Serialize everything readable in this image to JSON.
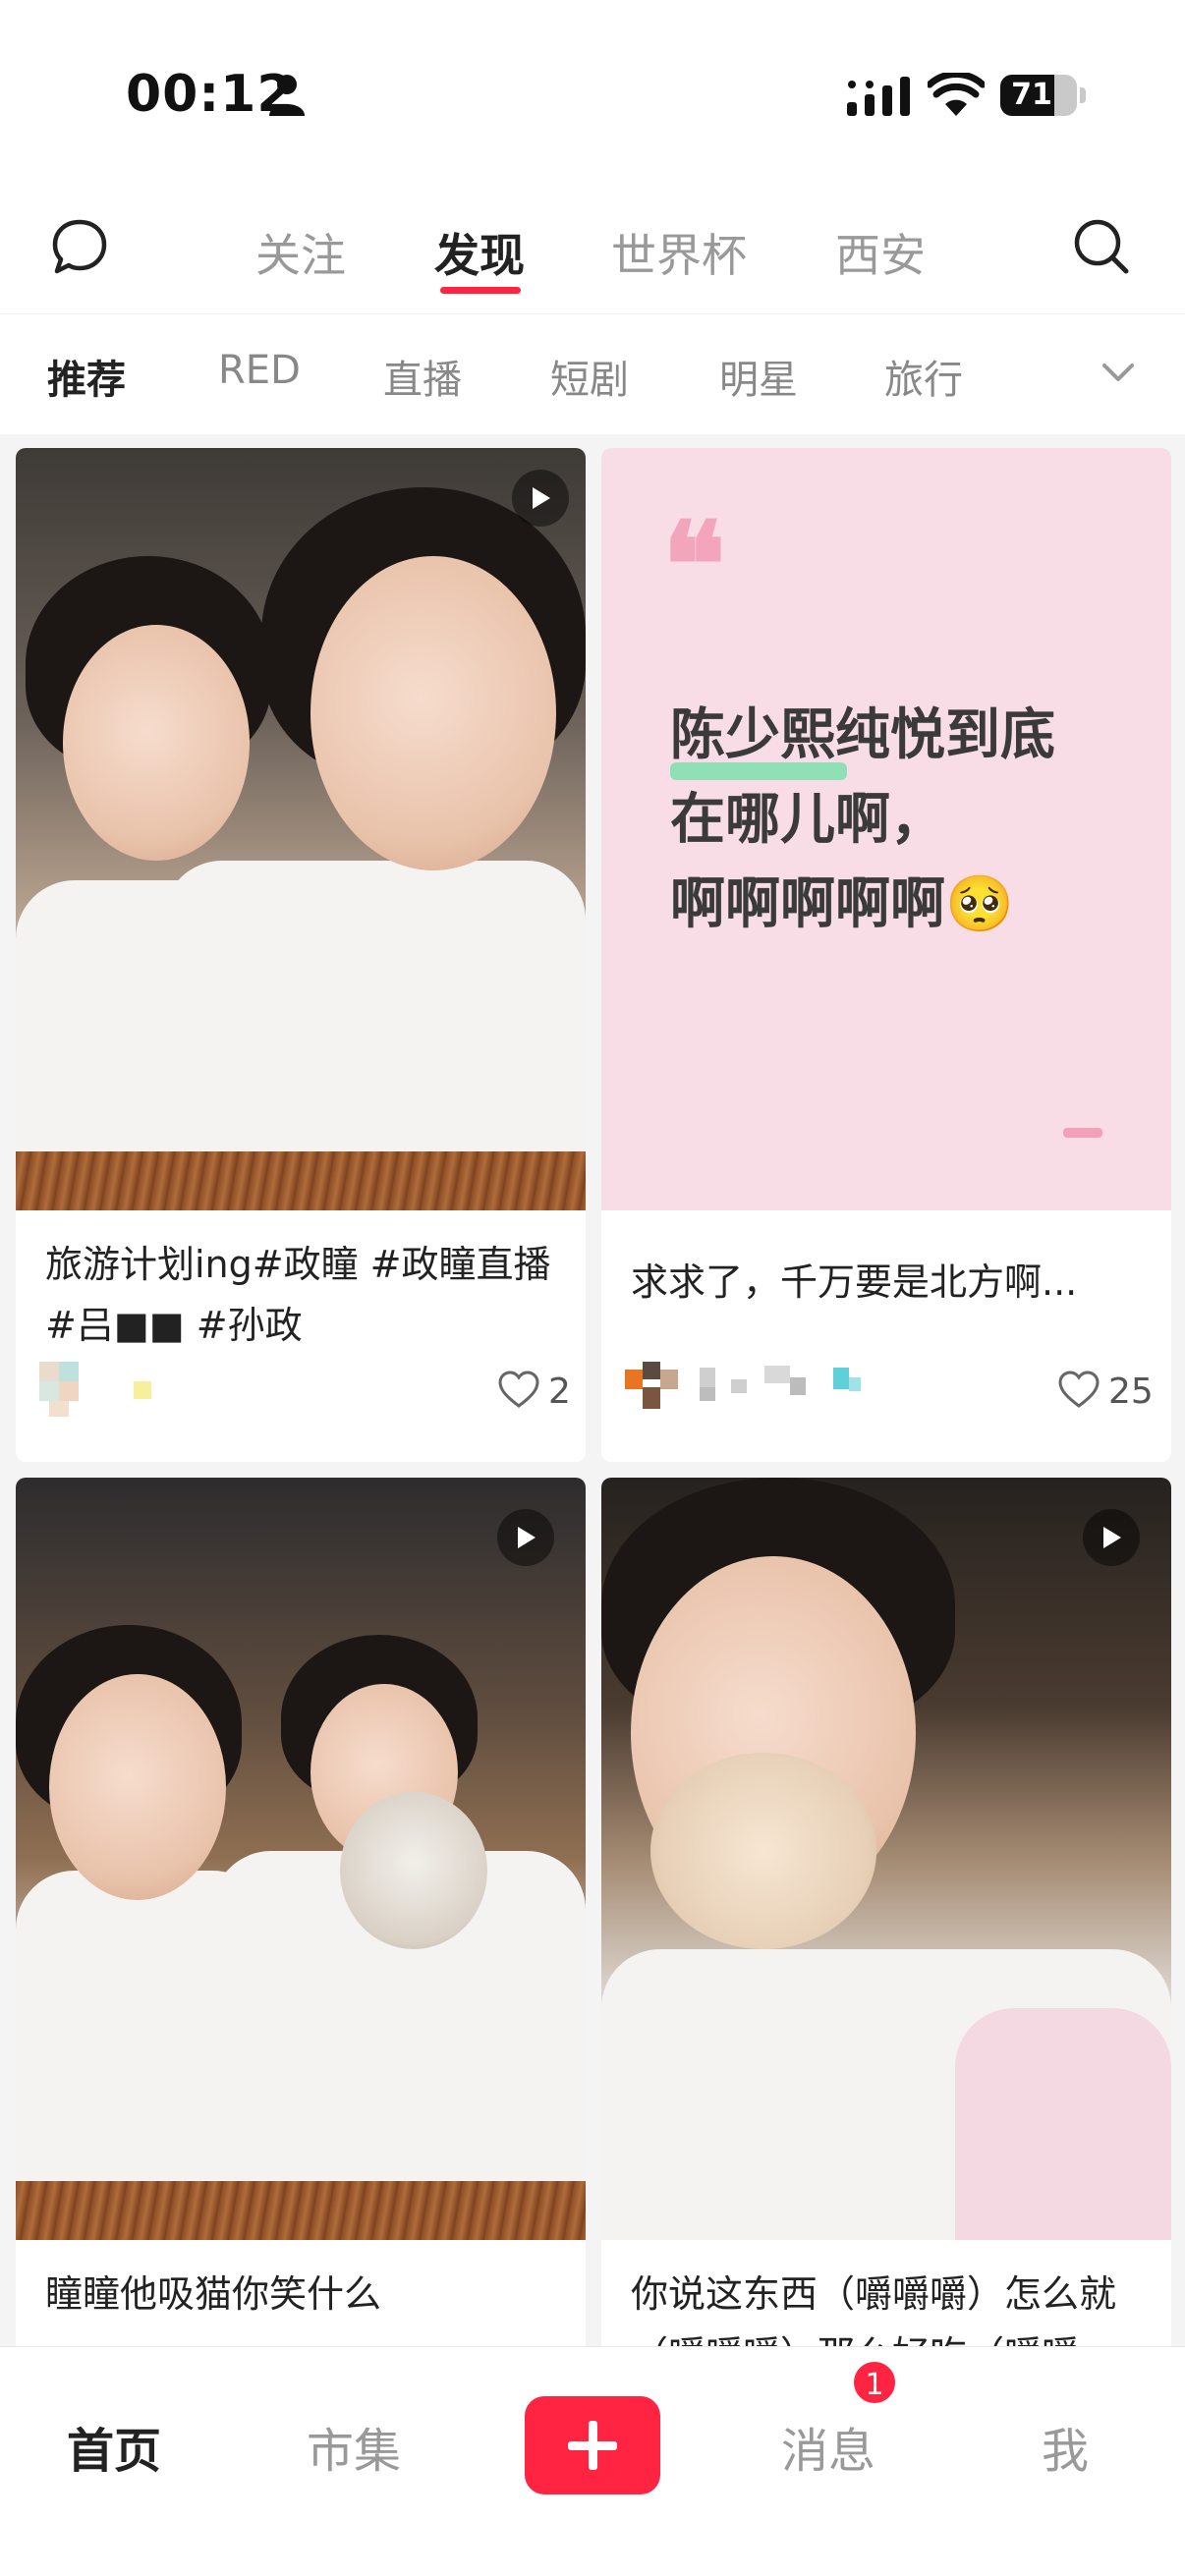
{
  "status_bar": {
    "time": "00:12",
    "battery": "71",
    "battery_level": 0.71
  },
  "top_nav": {
    "tabs": [
      {
        "label": "关注"
      },
      {
        "label": "发现",
        "active": true
      },
      {
        "label": "世界杯"
      },
      {
        "label": "西安"
      }
    ],
    "icons": [
      "chat-icon",
      "search-icon"
    ]
  },
  "channels": {
    "items": [
      "推荐",
      "RED",
      "直播",
      "短剧",
      "明星",
      "旅行"
    ],
    "active": "推荐",
    "expand_icon": "chevron-down-icon"
  },
  "feed": {
    "cards": [
      {
        "type": "video",
        "title": "旅游计划ing#政瞳 #政瞳直播 #吕■■ #孙政",
        "likes": "2"
      },
      {
        "type": "quote",
        "quote_lines": [
          "陈少熙纯悦到底",
          "在哪儿啊，",
          "啊啊啊啊啊🥺"
        ],
        "title": "求求了，千万要是北方啊...",
        "likes": "25"
      },
      {
        "type": "video",
        "title": "瞳瞳他吸猫你笑什么"
      },
      {
        "type": "video",
        "title": "你说这东西（嚼嚼嚼）怎么就（嚼嚼嚼）那么好吃（嚼嚼"
      }
    ]
  },
  "bottom_nav": {
    "tabs": [
      {
        "label": "首页",
        "active": true
      },
      {
        "label": "市集"
      },
      {
        "label": "消息",
        "badge": "1"
      },
      {
        "label": "我"
      }
    ],
    "create_icon": "plus-icon",
    "accent": "#ff2442"
  }
}
